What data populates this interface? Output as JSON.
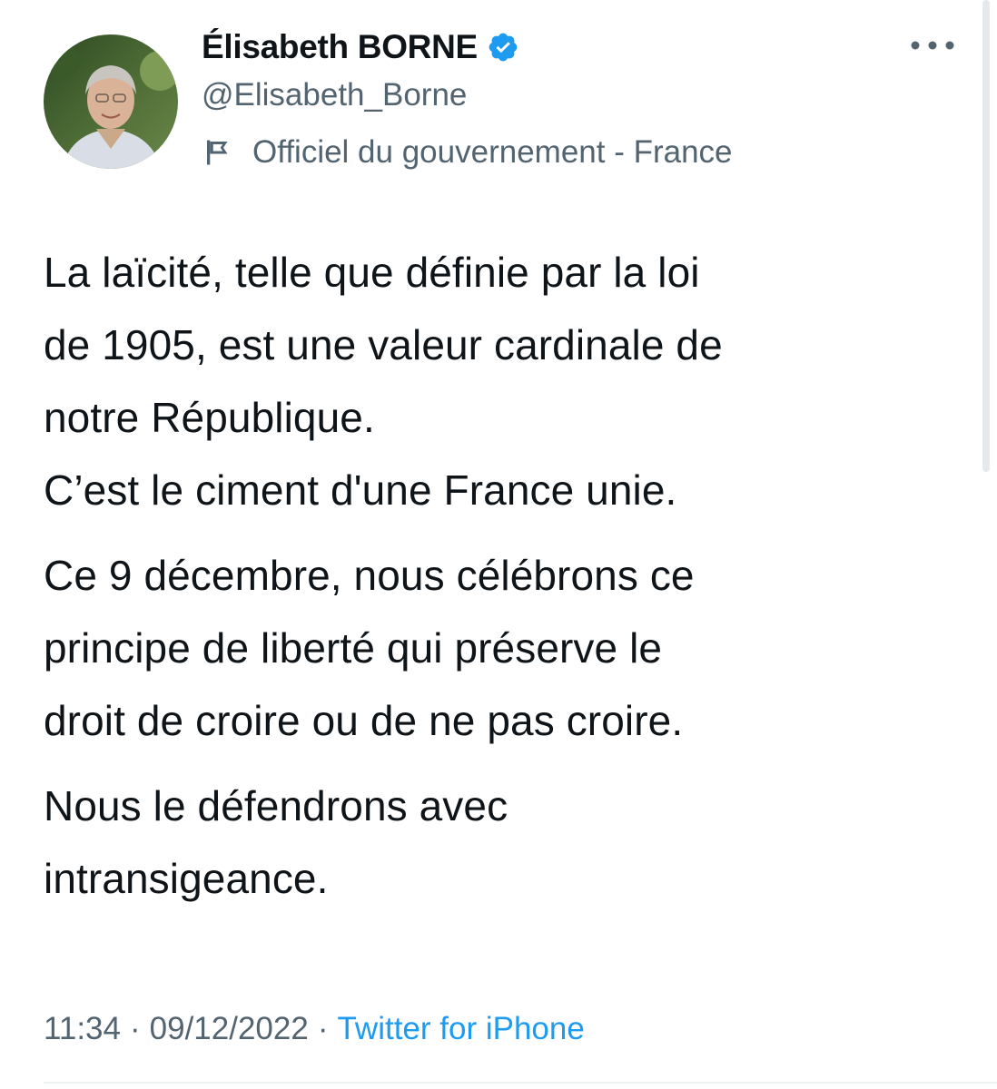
{
  "author": {
    "display_name": "Élisabeth BORNE",
    "handle": "@Elisabeth_Borne",
    "verified": true,
    "label": "Officiel du gouvernement - France",
    "avatar": "profile-photo"
  },
  "tweet": {
    "paragraphs": [
      [
        "La laïcité, telle que définie par la loi",
        "de 1905, est une valeur cardinale de",
        "notre République.",
        "C’est le ciment d'une France unie."
      ],
      [
        "Ce 9 décembre, nous célébrons ce",
        "principe de liberté qui préserve le",
        "droit de croire ou de ne pas croire."
      ],
      [
        "Nous le défendrons avec",
        "intransigeance."
      ]
    ]
  },
  "meta": {
    "time": "11:34",
    "separator": "·",
    "date": "09/12/2022",
    "source": "Twitter for iPhone"
  },
  "icons": {
    "verified": "verified-badge-icon",
    "label": "flag-icon",
    "more": "more-options-icon"
  },
  "colors": {
    "text": "#0f1419",
    "secondary": "#536471",
    "accent": "#1d9bf0"
  }
}
